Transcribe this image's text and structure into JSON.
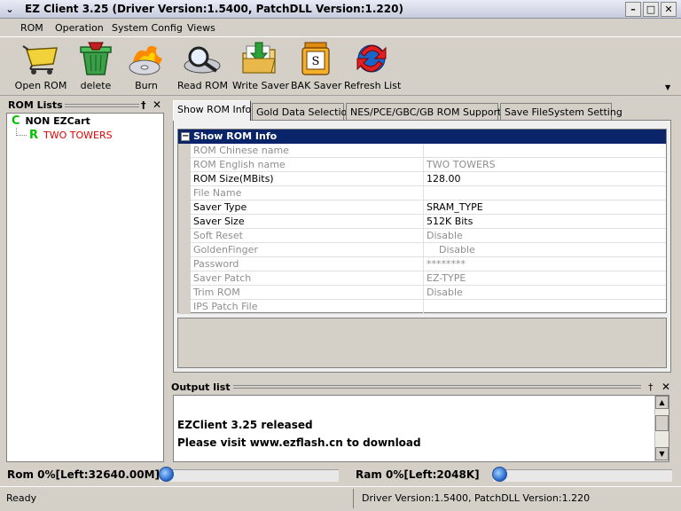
{
  "window": {
    "title": "EZ Client 3.25 (Driver Version:1.5400, PatchDLL Version:1.220)",
    "system_menu_icon": "chevron-down-icon",
    "controls": [
      "minimize-icon",
      "maximize-icon",
      "close-icon"
    ]
  },
  "menu": {
    "items": [
      {
        "label": "ROM"
      },
      {
        "label": "Operation"
      },
      {
        "label": "System Config"
      },
      {
        "label": "Views"
      }
    ]
  },
  "toolbar": {
    "buttons": [
      {
        "label": "Open ROM",
        "icon": "cart-icon"
      },
      {
        "label": "delete",
        "icon": "trash-icon"
      },
      {
        "label": "Burn",
        "icon": "burning-disc-icon"
      },
      {
        "label": "Read ROM",
        "icon": "magnifier-icon"
      },
      {
        "label": "Write Saver",
        "icon": "folder-download-icon"
      },
      {
        "label": "BAK Saver",
        "icon": "save-jar-icon"
      },
      {
        "label": "Refresh List",
        "icon": "refresh-icon"
      }
    ],
    "overflow_icon": "chevron-down-icon"
  },
  "rom_lists": {
    "title": "ROM Lists",
    "pin_glyph": "†",
    "close_glyph": "✕",
    "tree": [
      {
        "letter": "C",
        "label": "NON EZCart",
        "color": "#000000"
      },
      {
        "letter": "R",
        "label": "TWO TOWERS",
        "color": "#e00000"
      }
    ]
  },
  "tabs": [
    {
      "label": "Show ROM Info",
      "active": true
    },
    {
      "label": "Gold Data Selection",
      "active": false
    },
    {
      "label": "NES/PCE/GBC/GB ROM Support",
      "active": false
    },
    {
      "label": "Save FileSystem Setting",
      "active": false
    }
  ],
  "rom_info": {
    "header": "Show ROM Info",
    "expander": "−",
    "rows": [
      {
        "name": "ROM Chinese name",
        "value": "",
        "enabled": false
      },
      {
        "name": "ROM English name",
        "value": "TWO TOWERS",
        "enabled": false
      },
      {
        "name": "ROM Size(MBits)",
        "value": "128.00",
        "enabled": true
      },
      {
        "name": "File Name",
        "value": "",
        "enabled": false
      },
      {
        "name": "Saver Type",
        "value": "SRAM_TYPE",
        "enabled": true
      },
      {
        "name": "Saver Size",
        "value": "512K Bits",
        "enabled": true
      },
      {
        "name": "Soft Reset",
        "value": "Disable",
        "enabled": false
      },
      {
        "name": "GoldenFinger",
        "value": "    Disable",
        "enabled": false
      },
      {
        "name": "Password",
        "value": "********",
        "enabled": false
      },
      {
        "name": "Saver Patch",
        "value": "EZ-TYPE",
        "enabled": false
      },
      {
        "name": "Trim ROM",
        "value": "Disable",
        "enabled": false
      },
      {
        "name": "IPS Patch File",
        "value": "",
        "enabled": false
      }
    ]
  },
  "output": {
    "title": "Output list",
    "pin_glyph": "†",
    "close_glyph": "✕",
    "lines": [
      "EZClient 3.25 released",
      "Please visit www.ezflash.cn to download"
    ],
    "scroll_up": "▲",
    "scroll_down": "▼"
  },
  "capacity": {
    "rom": {
      "label": "Rom  0%[Left:32640.00M]",
      "percent": 0
    },
    "ram": {
      "label": "Ram  0%[Left:2048K]",
      "percent": 0
    }
  },
  "statusbar": {
    "left": "Ready",
    "right": "Driver Version:1.5400, PatchDLL Version:1.220"
  }
}
